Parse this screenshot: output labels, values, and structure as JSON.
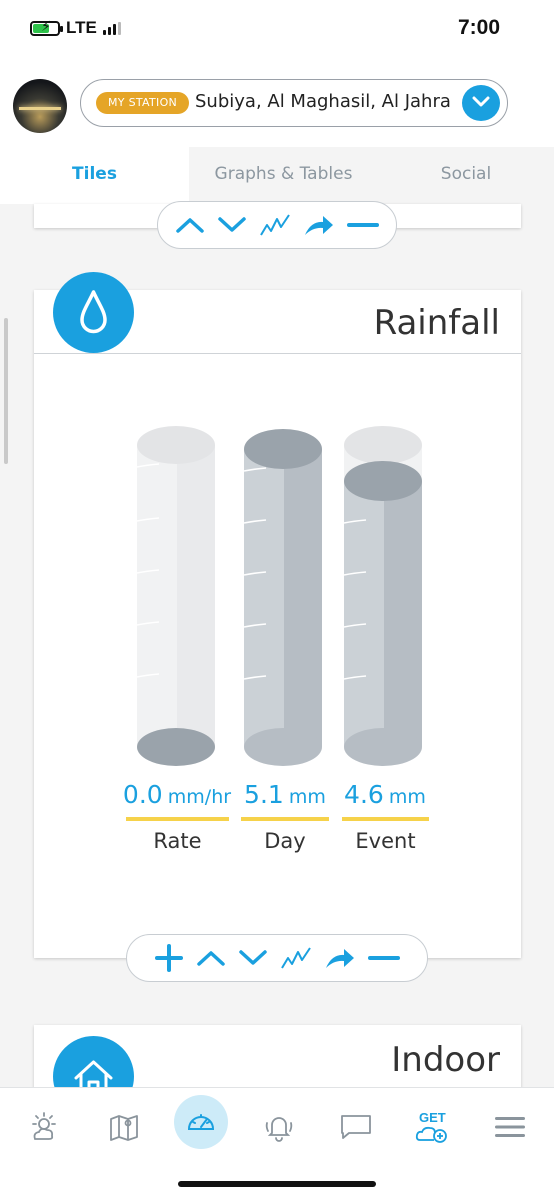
{
  "status_bar": {
    "network": "LTE",
    "time": "7:00",
    "battery_color": "#2ec24a"
  },
  "header": {
    "avatar": "station-photo",
    "badge": "MY STATION",
    "station_name": "Subiya, Al Maghasil, Al Jahra",
    "badge_color": "#e5a527",
    "accent_color": "#1aa0df"
  },
  "tabs": [
    {
      "label": "Tiles",
      "active": true
    },
    {
      "label": "Graphs & Tables",
      "active": false
    },
    {
      "label": "Social",
      "active": false
    }
  ],
  "tiles": {
    "previous": {
      "controls": [
        "chevron-up-icon",
        "chevron-down-icon",
        "graph-icon",
        "share-arrow-icon",
        "minus-icon"
      ]
    },
    "rainfall": {
      "title": "Rainfall",
      "icon": "raindrop-icon",
      "gauges": [
        {
          "value": "0.0",
          "unit": "mm/hr",
          "label": "Rate",
          "fill_fraction": 0.0
        },
        {
          "value": "5.1",
          "unit": "mm",
          "label": "Day",
          "fill_fraction": 1.0
        },
        {
          "value": "4.6",
          "unit": "mm",
          "label": "Event",
          "fill_fraction": 0.9
        }
      ],
      "controls": [
        "plus-icon",
        "chevron-up-icon",
        "chevron-down-icon",
        "graph-icon",
        "share-arrow-icon",
        "minus-icon"
      ]
    },
    "indoor": {
      "title": "Indoor",
      "icon": "house-icon"
    }
  },
  "bottom_nav": {
    "items": [
      {
        "icon": "weather-icon",
        "active": false
      },
      {
        "icon": "map-icon",
        "active": false
      },
      {
        "icon": "dashboard-gauge-icon",
        "active": true
      },
      {
        "icon": "alerts-bell-icon",
        "active": false
      },
      {
        "icon": "chat-icon",
        "active": false
      },
      {
        "icon": "get-cloud-icon",
        "label": "GET",
        "active": false
      },
      {
        "icon": "menu-icon",
        "active": false
      }
    ]
  }
}
